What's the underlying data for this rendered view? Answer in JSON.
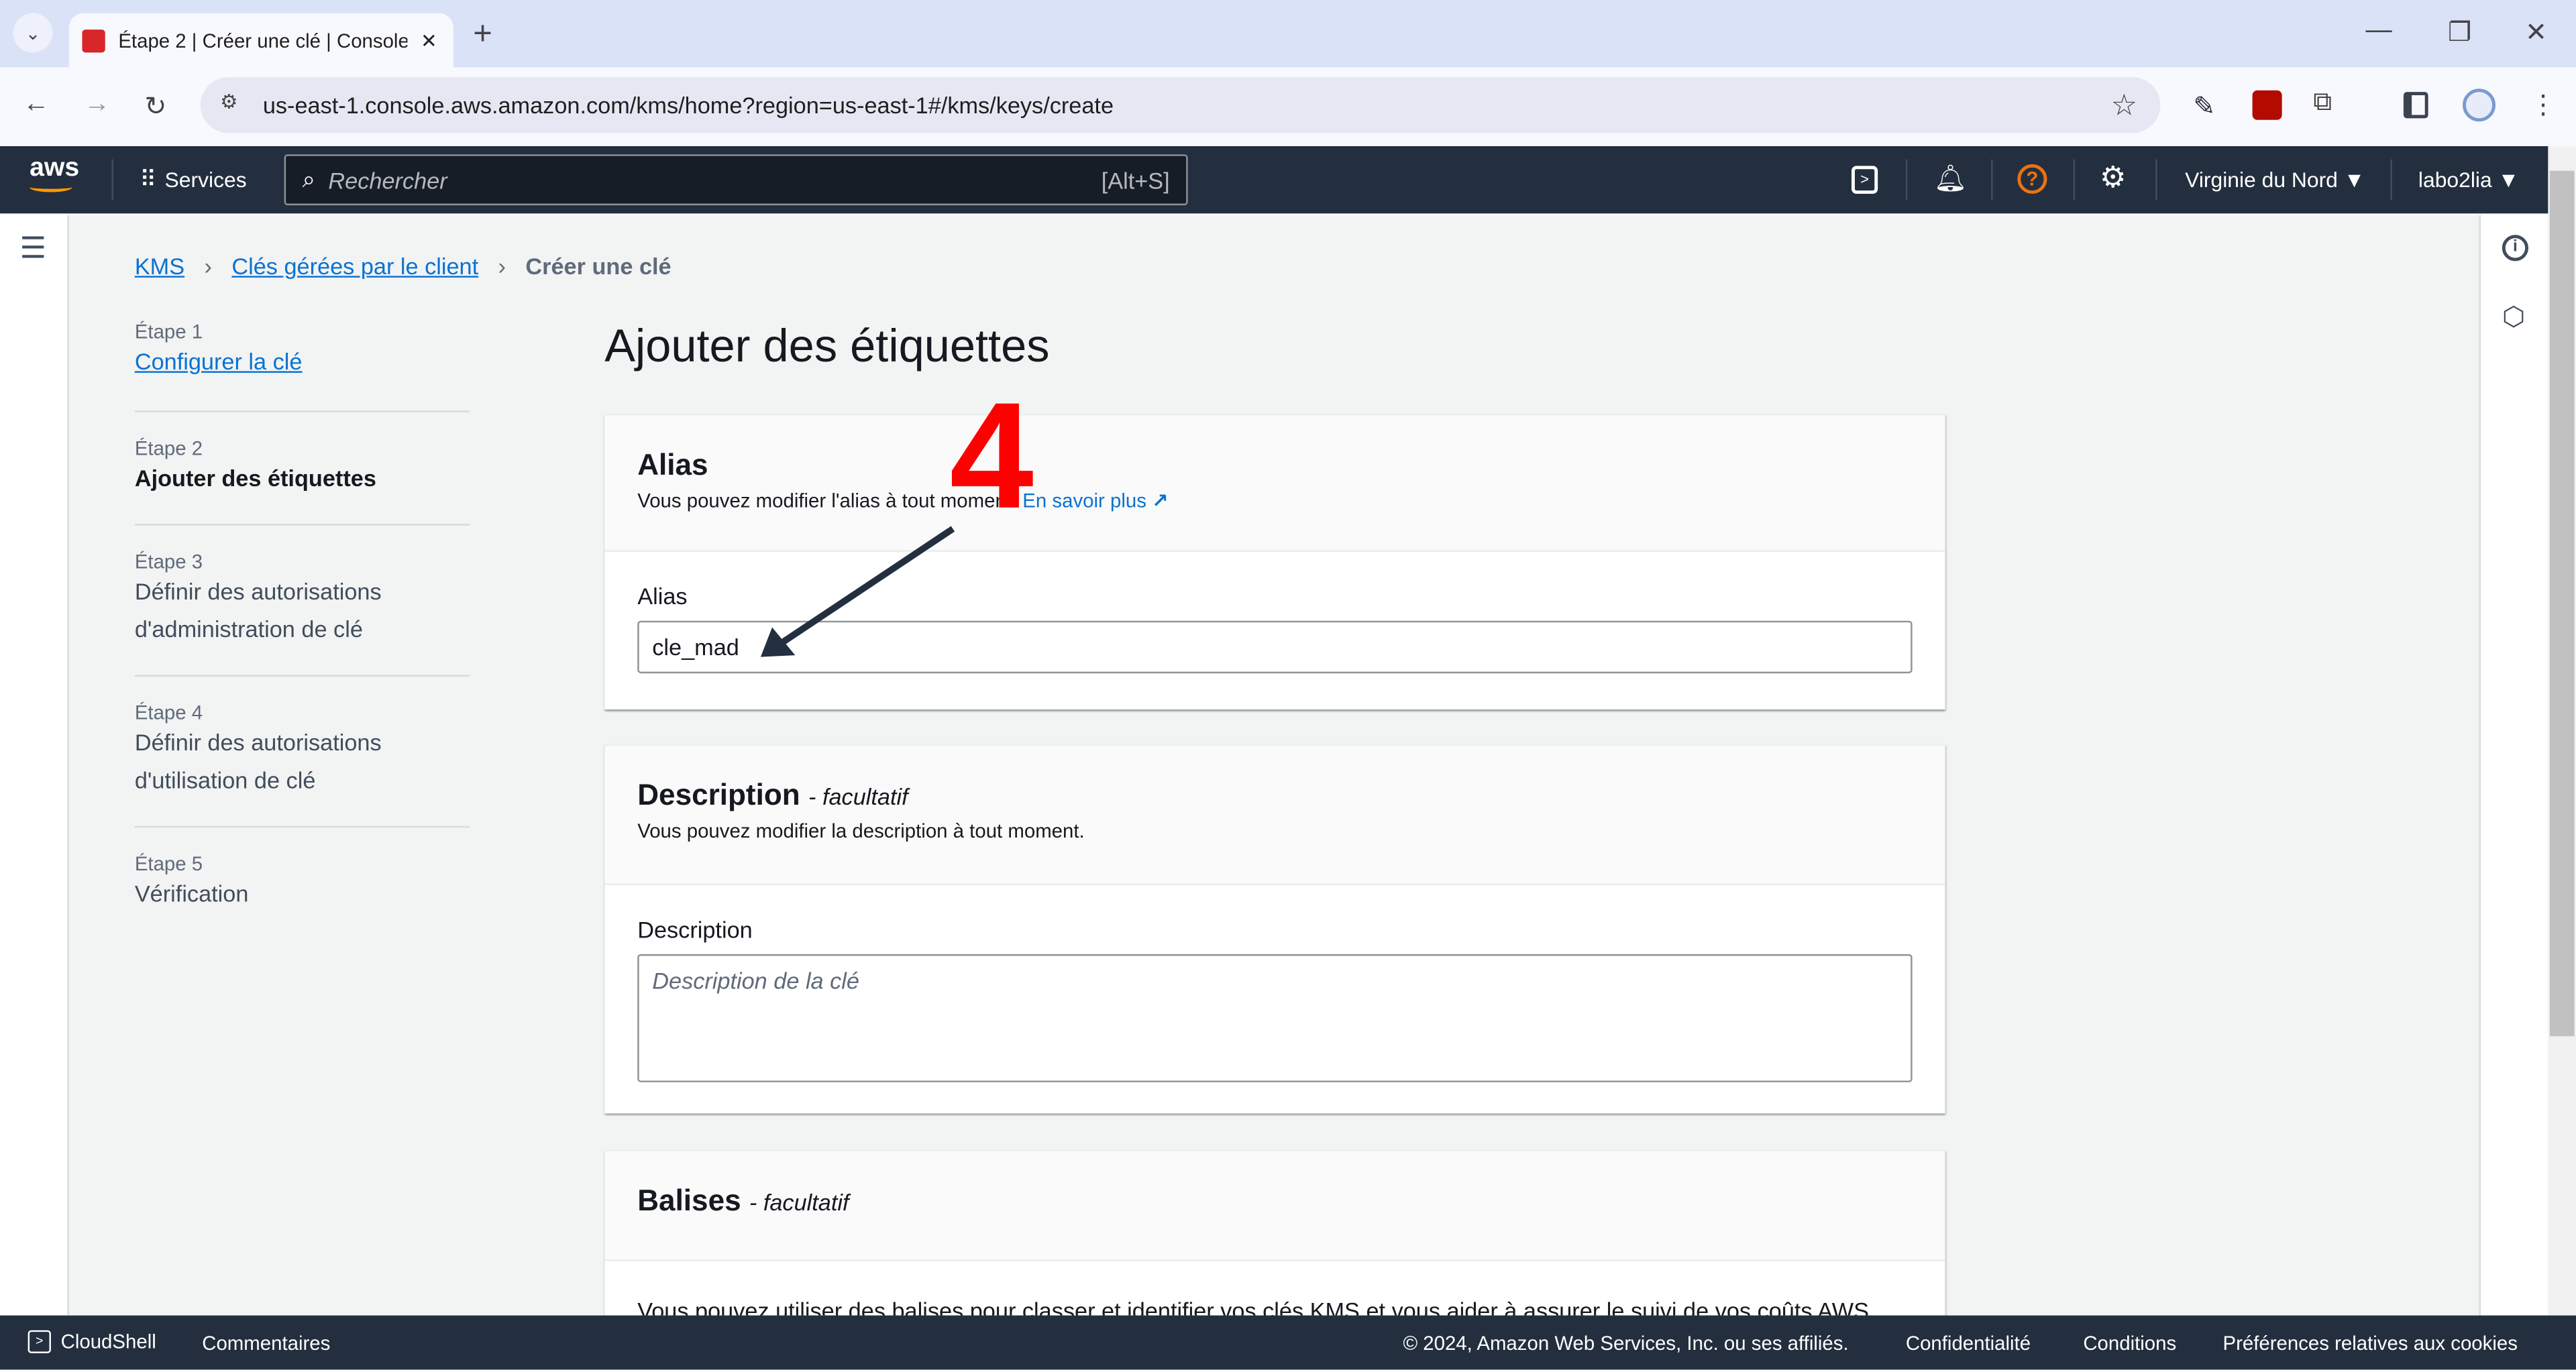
{
  "browser": {
    "tab_title": "Étape 2 | Créer une clé | Console",
    "url": "us-east-1.console.aws.amazon.com/kms/home?region=us-east-1#/kms/keys/create"
  },
  "awsnav": {
    "logo": "aws",
    "services": "Services",
    "search_placeholder": "Rechercher",
    "search_shortcut": "[Alt+S]",
    "region": "Virginie du Nord",
    "account": "labo2lia"
  },
  "breadcrumb": [
    "KMS",
    "Clés gérées par le client",
    "Créer une clé"
  ],
  "steps": [
    {
      "label": "Étape 1",
      "text": "Configurer la clé"
    },
    {
      "label": "Étape 2",
      "text": "Ajouter des étiquettes"
    },
    {
      "label": "Étape 3",
      "text": "Définir des autorisations d'administration de clé"
    },
    {
      "label": "Étape 4",
      "text": "Définir des autorisations d'utilisation de clé"
    },
    {
      "label": "Étape 5",
      "text": "Vérification"
    }
  ],
  "page_title": "Ajouter des étiquettes",
  "alias_panel": {
    "title": "Alias",
    "subtitle": "Vous pouvez modifier l'alias à tout moment.",
    "learn_more": "En savoir plus",
    "field_label": "Alias",
    "value": "cle_mad"
  },
  "description_panel": {
    "title": "Description",
    "optional": "- facultatif",
    "subtitle": "Vous pouvez modifier la description à tout moment.",
    "field_label": "Description",
    "placeholder": "Description de la clé"
  },
  "tags_panel": {
    "title": "Balises",
    "optional": "- facultatif",
    "text": "Vous pouvez utiliser des balises pour classer et identifier vos clés KMS et vous aider à assurer le suivi de vos coûts AWS."
  },
  "annotation": {
    "number": "4",
    "color": "#ff0000"
  },
  "footer": {
    "cloudshell": "CloudShell",
    "feedback": "Commentaires",
    "copyright": "© 2024, Amazon Web Services, Inc. ou ses affiliés.",
    "privacy": "Confidentialité",
    "terms": "Conditions",
    "cookies": "Préférences relatives aux cookies"
  }
}
